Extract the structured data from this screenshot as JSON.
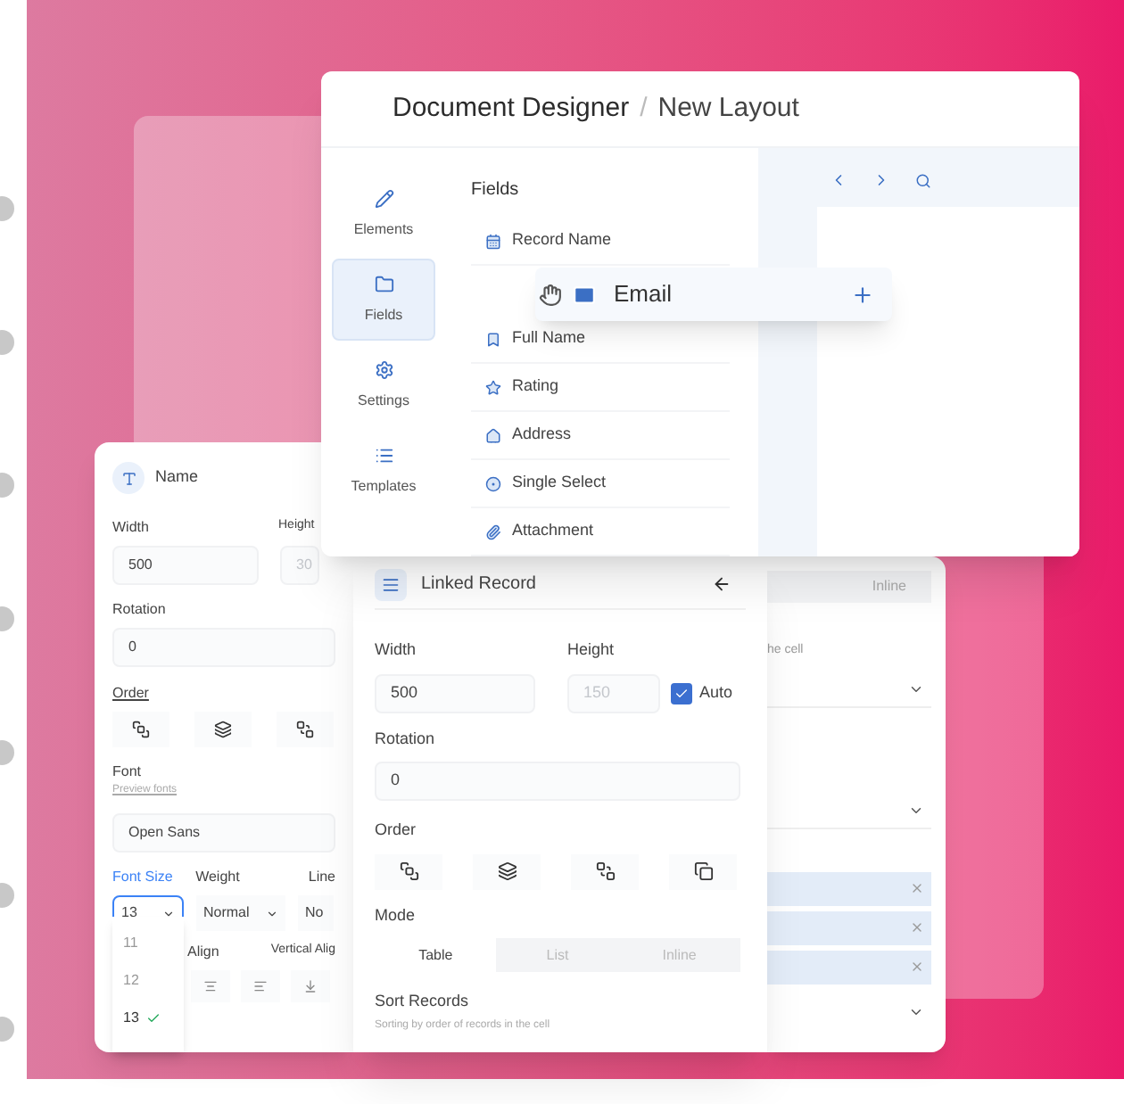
{
  "main_window": {
    "title": "Document Designer",
    "separator": "/",
    "subtitle": "New Layout",
    "nav": [
      {
        "label": "Elements",
        "selected": false
      },
      {
        "label": "Fields",
        "selected": true
      },
      {
        "label": "Settings",
        "selected": false
      },
      {
        "label": "Templates",
        "selected": false
      }
    ],
    "fields_heading": "Fields",
    "fields": [
      "Record Name",
      "Full Name",
      "Rating",
      "Address",
      "Single Select",
      "Attachment"
    ],
    "dragged_field": {
      "label": "Email"
    }
  },
  "name_panel": {
    "title": "Name",
    "width": {
      "label": "Width",
      "value": "500"
    },
    "height": {
      "label": "Height",
      "value": "30",
      "disabled": true
    },
    "rotation": {
      "label": "Rotation",
      "value": "0"
    },
    "order_label": "Order",
    "font_label": "Font",
    "font_hint": "Preview fonts",
    "font_value": "Open Sans",
    "font_size": {
      "label": "Font Size",
      "value": "13",
      "focused": true
    },
    "weight": {
      "label": "Weight",
      "value": "Normal"
    },
    "line": {
      "label": "Line",
      "value": "No"
    },
    "align_label": "Align",
    "vertical_align_label": "Vertical Alig",
    "size_options": [
      {
        "label": "11",
        "selected": false
      },
      {
        "label": "12",
        "selected": false
      },
      {
        "label": "13",
        "selected": true
      }
    ]
  },
  "linked_panel": {
    "title": "Linked Record",
    "width": {
      "label": "Width",
      "value": "500"
    },
    "height": {
      "label": "Height",
      "value": "150",
      "disabled": true
    },
    "auto": {
      "label": "Auto",
      "checked": true
    },
    "rotation": {
      "label": "Rotation",
      "value": "0"
    },
    "order_label": "Order",
    "mode_label": "Mode",
    "modes": [
      {
        "label": "Table",
        "selected": true
      },
      {
        "label": "List",
        "selected": false
      },
      {
        "label": "Inline",
        "selected": false
      }
    ],
    "sort_label": "Sort Records",
    "sort_hint": "Sorting by order of records in the cell"
  },
  "back_panel": {
    "tab": "Inline",
    "hint": "he cell",
    "chips": [
      {
        "selected": true
      },
      {
        "selected": true
      },
      {
        "selected": true
      }
    ]
  }
}
